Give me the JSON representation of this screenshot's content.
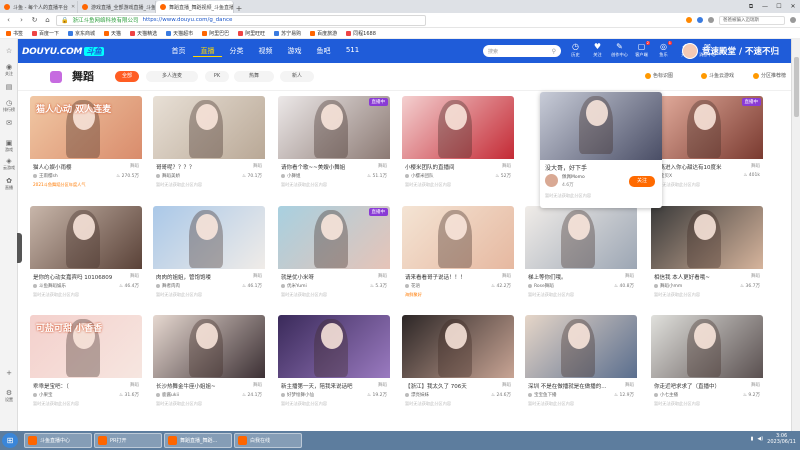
{
  "browser": {
    "tabs": [
      {
        "label": "斗鱼 - 每个人的直播平台",
        "active": false
      },
      {
        "label": "游戏直播_全部游戏直播_斗鱼直播",
        "active": false
      },
      {
        "label": "舞蹈直播_舞蹈视频_斗鱼直播",
        "active": true
      }
    ],
    "new_tab": "+",
    "window_controls": [
      "⧉",
      "—",
      "☐",
      "✕"
    ],
    "security_label": "浙江斗鱼网络科技有限公司",
    "url": "https://www.douyu.com/g_dance",
    "address_search": "爸爸被骗入迈瑞斯",
    "bookmarks": [
      "书签",
      "百度一下",
      "京东商城",
      "天猫",
      "天猫精选",
      "天猫超市",
      "阿里巴巴",
      "阿里旺旺",
      "苏宁易购",
      "百度旅游",
      "同程1688"
    ]
  },
  "left_sidebar": {
    "items": [
      {
        "icon": "☆",
        "label": ""
      },
      {
        "icon": "◉",
        "label": "关注"
      },
      {
        "icon": "▤",
        "label": ""
      },
      {
        "icon": "◷",
        "label": "排行榜"
      },
      {
        "icon": "✉",
        "label": ""
      },
      {
        "icon": "▣",
        "label": "游戏"
      },
      {
        "icon": "◈",
        "label": "云游戏"
      },
      {
        "icon": "✿",
        "label": "直播"
      },
      {
        "icon": "+",
        "label": ""
      },
      {
        "icon": "⚙",
        "label": "设置"
      }
    ]
  },
  "site": {
    "logo": "DOUYU.COM",
    "logo_badge": "斗鱼",
    "nav": [
      {
        "label": "首页",
        "active": false
      },
      {
        "label": "直播",
        "active": true
      },
      {
        "label": "分类",
        "active": false
      },
      {
        "label": "视频",
        "active": false
      },
      {
        "label": "游戏",
        "active": false
      },
      {
        "label": "鱼吧",
        "active": false
      },
      {
        "label": "511",
        "active": false
      }
    ],
    "search_placeholder": "搜索",
    "header_icons": [
      {
        "icon": "◷",
        "label": "历史",
        "badge": ""
      },
      {
        "icon": "♥",
        "label": "关注",
        "badge": ""
      },
      {
        "icon": "✎",
        "label": "创作中心",
        "badge": ""
      },
      {
        "icon": "▢",
        "label": "客户端",
        "badge": "2"
      },
      {
        "icon": "◎",
        "label": "鱼乐",
        "badge": "1"
      },
      {
        "icon": "◆",
        "label": "开播",
        "badge": ""
      },
      {
        "icon": "✉",
        "label": "消息中心",
        "badge": ""
      }
    ],
    "slogan": "竞速殿堂 / 不速不归"
  },
  "category": {
    "title": "舞蹈",
    "filters": [
      {
        "label": "全部",
        "active": true
      },
      {
        "label": "多人连麦",
        "active": false
      },
      {
        "label": "PK",
        "active": false
      },
      {
        "label": "热舞",
        "active": false
      },
      {
        "label": "新人",
        "active": false
      }
    ],
    "right_links": [
      "色标识图",
      "斗鱼云游戏",
      "分区推荐榜"
    ]
  },
  "cards": [
    {
      "title": "猫人心娱小雨樱",
      "category": "舞蹈",
      "author": "王雨樱sh",
      "heat": "270.5万",
      "sub": "2021斗鱼舞蹈分区年度人气",
      "sub_rank": true,
      "live": false,
      "cover": "猫人心动 双人连麦",
      "colors": [
        "#f1c8a4",
        "#d98c6c"
      ]
    },
    {
      "title": "哥哥呢？？？？",
      "category": "舞蹈",
      "author": "舞蹈美娇",
      "heat": "70.1万",
      "sub": "暂时无法获取此分区内容",
      "sub_rank": false,
      "live": false,
      "cover": "",
      "colors": [
        "#e8e0d6",
        "#b9a896"
      ]
    },
    {
      "title": "请你看个歌~~美嫂小舞姐",
      "category": "舞蹈",
      "author": "小舞姐",
      "heat": "51.1万",
      "sub": "暂时无法获取此分区内容",
      "sub_rank": false,
      "live": true,
      "cover": "",
      "colors": [
        "#ece8e8",
        "#8c7a74"
      ]
    },
    {
      "title": "小樱米团队的直播间",
      "category": "舞蹈",
      "author": "小樱米团队",
      "heat": "52万",
      "sub": "暂时无法获取此分区内容",
      "sub_rank": false,
      "live": false,
      "cover": "",
      "colors": [
        "#f4d0d0",
        "#c42a35"
      ]
    },
    {
      "title": "甜离进入你心甜达有10度米",
      "category": "舞蹈",
      "author": "宝贝X",
      "heat": "401k",
      "sub": "暂时无法获取此分区内容",
      "sub_rank": false,
      "live": true,
      "cover": "",
      "colors": [
        "#e6b0a0",
        "#7a3a30"
      ]
    },
    {
      "title": "是你的心动女嘉宾吗 10106809",
      "category": "舞蹈",
      "author": "斗鱼舞蹈娱乐",
      "heat": "46.4万",
      "sub": "暂时无法获取此分区内容",
      "sub_rank": false,
      "live": false,
      "cover": "",
      "colors": [
        "#c8b6aa",
        "#5a4238"
      ]
    },
    {
      "title": "肉肉的姐姐，管饱饱喽",
      "category": "舞蹈",
      "author": "舞者肉肉",
      "heat": "46.1万",
      "sub": "暂时无法获取此分区内容",
      "sub_rank": false,
      "live": false,
      "cover": "",
      "colors": [
        "#aac8e8",
        "#f0ece8"
      ]
    },
    {
      "title": "就是优小米呀",
      "category": "舞蹈",
      "author": "优米Yumi",
      "heat": "5.3万",
      "sub": "暂时无法获取此分区内容",
      "sub_rank": false,
      "live": true,
      "cover": "",
      "colors": [
        "#a8d0e0",
        "#e6c4b8"
      ]
    },
    {
      "title": "请来看看哥子说话！！！",
      "category": "舞蹈",
      "author": "花语",
      "heat": "42.2万",
      "sub": "海鲜聚好",
      "sub_rank": true,
      "live": false,
      "cover": "",
      "colors": [
        "#f4e4d4",
        "#e6b8a0"
      ]
    },
    {
      "title": "梯上等你们哦。",
      "category": "舞蹈",
      "author": "Rose舞蹈",
      "heat": "40.8万",
      "sub": "暂时无法获取此分区内容",
      "sub_rank": false,
      "live": false,
      "cover": "",
      "colors": [
        "#f0ece8",
        "#9ca6b4"
      ]
    },
    {
      "title": "相信我 本人更好看哦~",
      "category": "舞蹈",
      "author": "舞蹈小mm",
      "heat": "36.7万",
      "sub": "暂时无法获取此分区内容",
      "sub_rank": false,
      "live": false,
      "cover": "",
      "colors": [
        "#3a3a3a",
        "#d6b49c"
      ]
    },
    {
      "title": "乖乖是宝吧：（",
      "category": "舞蹈",
      "author": "小果宝",
      "heat": "31.6万",
      "sub": "暂时无法获取此分区内容",
      "sub_rank": false,
      "live": false,
      "cover": "可盐可甜 小香香",
      "colors": [
        "#f4d0cc",
        "#f6e6e0"
      ]
    },
    {
      "title": "长沙热舞金牛座小姐姐~",
      "category": "舞蹈",
      "author": "鹿酱ukii",
      "heat": "24.1万",
      "sub": "暂时无法获取此分区内容",
      "sub_rank": false,
      "live": false,
      "cover": "",
      "colors": [
        "#e6d8d0",
        "#3c3034"
      ]
    },
    {
      "title": "新主播第一天，陪我来说话吧",
      "category": "舞蹈",
      "author": "好梦绘舞小仙",
      "heat": "19.2万",
      "sub": "暂时无法获取此分区内容",
      "sub_rank": false,
      "live": false,
      "cover": "",
      "colors": [
        "#3a2a5a",
        "#9a7ac0"
      ]
    },
    {
      "title": "【浙江】我太久了 706天",
      "category": "舞蹈",
      "author": "漂亮妹妹",
      "heat": "24.6万",
      "sub": "暂时无法获取此分区内容",
      "sub_rank": false,
      "live": false,
      "cover": "",
      "colors": [
        "#2c2626",
        "#c8a494"
      ]
    },
    {
      "title": "深圳 不是在做播就是在做播的...",
      "category": "舞蹈",
      "author": "宝宝鱼下播",
      "heat": "12.9万",
      "sub": "暂时无法获取此分区内容",
      "sub_rank": false,
      "live": false,
      "cover": "",
      "colors": [
        "#e6d6c8",
        "#5a6e8e"
      ]
    },
    {
      "title": "你走近吧求求了（直播中）",
      "category": "舞蹈",
      "author": "小七主播",
      "heat": "9.2万",
      "sub": "暂时无法获取此分区内容",
      "sub_rank": false,
      "live": false,
      "cover": "",
      "colors": [
        "#e0e0dc",
        "#5a5050"
      ]
    }
  ],
  "hover_card": {
    "title": "没大哥，好下手",
    "author": "佩佩Momo",
    "fans": "4.6万",
    "follow": "关注",
    "sub": "暂时无法获取此分区内容",
    "colors": [
      "#c8ccd8",
      "#4a4e66"
    ]
  },
  "taskbar": {
    "start": "⊞",
    "items": [
      {
        "label": "斗鱼直播中心"
      },
      {
        "label": "PR打开"
      },
      {
        "label": "舞蹈直播_舞蹈..."
      },
      {
        "label": "白我在线"
      }
    ],
    "time": "3:06",
    "date": "2023/06/11"
  }
}
